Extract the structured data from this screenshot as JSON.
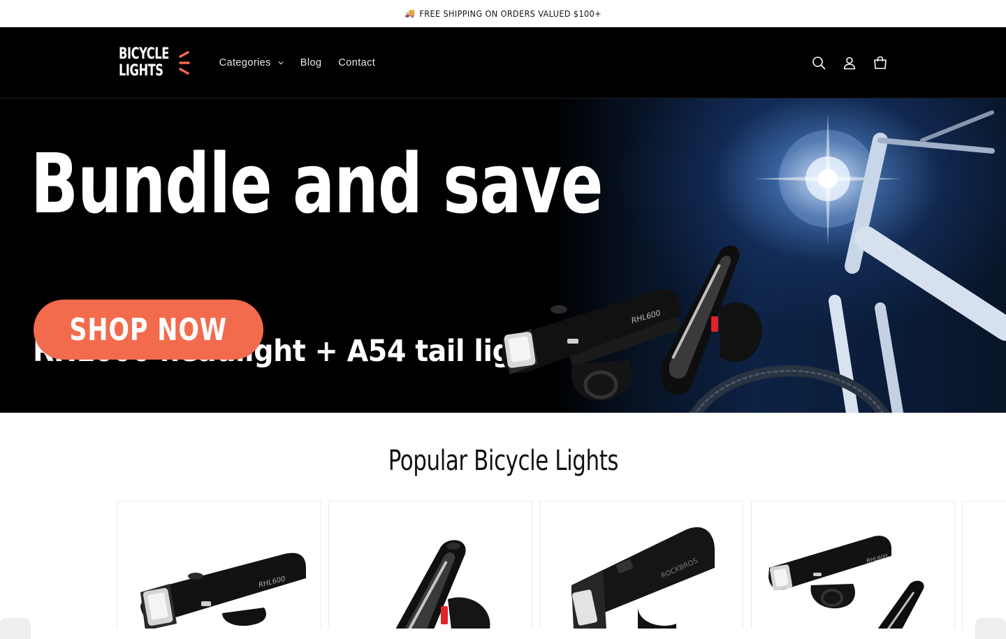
{
  "announcement": {
    "icon": "truck-icon",
    "text": "FREE SHIPPING ON ORDERS VALUED $100+"
  },
  "header": {
    "logo": {
      "line1": "BICYCLE",
      "line2": "LIGHTS",
      "accent": "#f26b4c"
    },
    "nav": [
      {
        "label": "Categories",
        "has_dropdown": true
      },
      {
        "label": "Blog"
      },
      {
        "label": "Contact"
      }
    ],
    "icons": [
      "search-icon",
      "account-icon",
      "cart-icon"
    ]
  },
  "hero": {
    "title": "Bundle and save",
    "subtitle": "RHL600 headlight + A54 tail light",
    "cta_label": "SHOP NOW",
    "cta_color": "#f26b4c",
    "headlight_model": "RHL600"
  },
  "popular": {
    "title": "Popular Bicycle Lights",
    "cards": [
      {
        "image": "headlight"
      },
      {
        "image": "tail-light"
      },
      {
        "image": "headlight-top-view"
      },
      {
        "image": "headlight-and-tail-light"
      },
      {
        "image": "partial"
      }
    ]
  }
}
